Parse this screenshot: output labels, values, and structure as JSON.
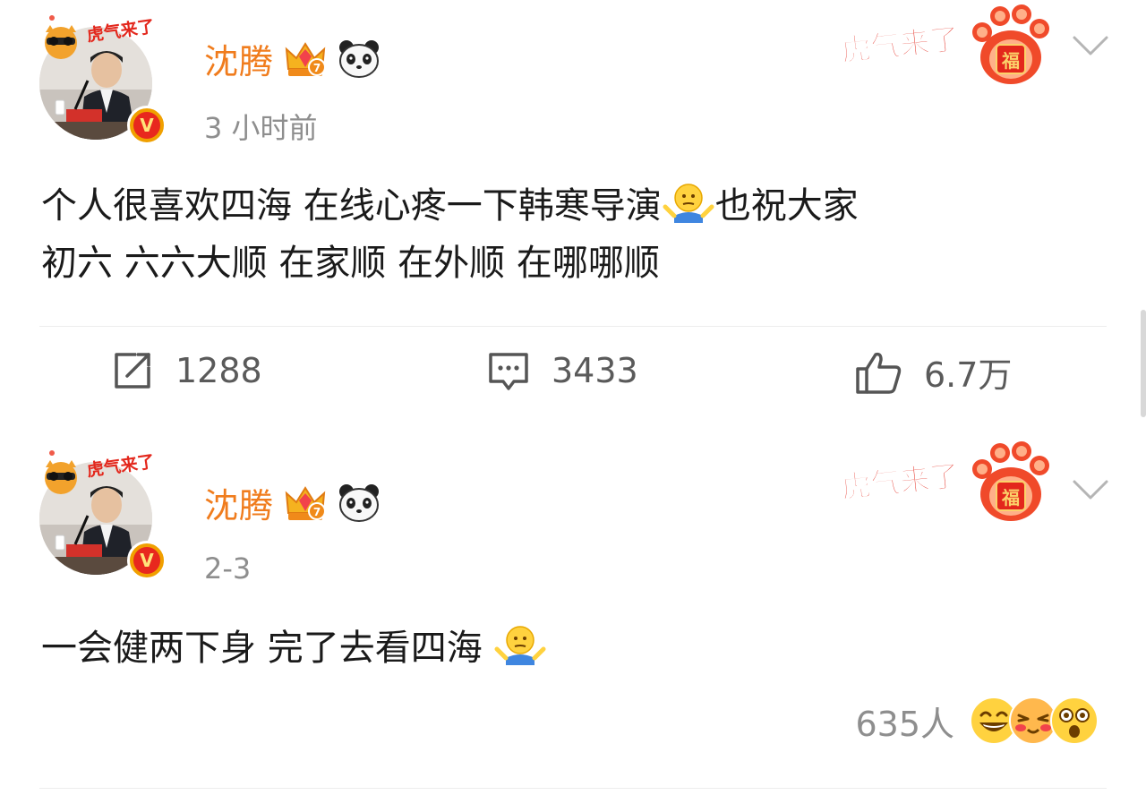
{
  "posts": [
    {
      "username": "沈腾",
      "timestamp": "3 小时前",
      "text_line1": "个人很喜欢四海 在线心疼一下韩寒导演",
      "text_line1_tail": "也祝大家",
      "text_line2": "初六 六六大顺 在家顺 在外顺 在哪哪顺",
      "avatar_badge_text": "虎气来了",
      "tiger_deco_text": "虎气来了",
      "tiger_deco_paw_text": "福",
      "repost_count": "1288",
      "comment_count": "3433",
      "like_count": "6.7万",
      "verified_mark": "V"
    },
    {
      "username": "沈腾",
      "timestamp": "2-3",
      "text": "一会健两下身 完了去看四海",
      "avatar_badge_text": "虎气来了",
      "tiger_deco_text": "虎气来了",
      "tiger_deco_paw_text": "福",
      "reaction_count": "635人",
      "verified_mark": "V"
    }
  ],
  "colors": {
    "username": "#f07c1d",
    "meta": "#8e8e8e",
    "text": "#1a1a1a",
    "action": "#5a5a5a",
    "verified": "#e8281e"
  },
  "icons": {
    "badge1": "crown-icon",
    "badge2": "panda-icon",
    "more": "chevron-down-icon",
    "repost": "repost-icon",
    "comment": "comment-icon",
    "like": "thumbs-up-icon",
    "shrug_emoji": "shrug-emoji-icon"
  }
}
